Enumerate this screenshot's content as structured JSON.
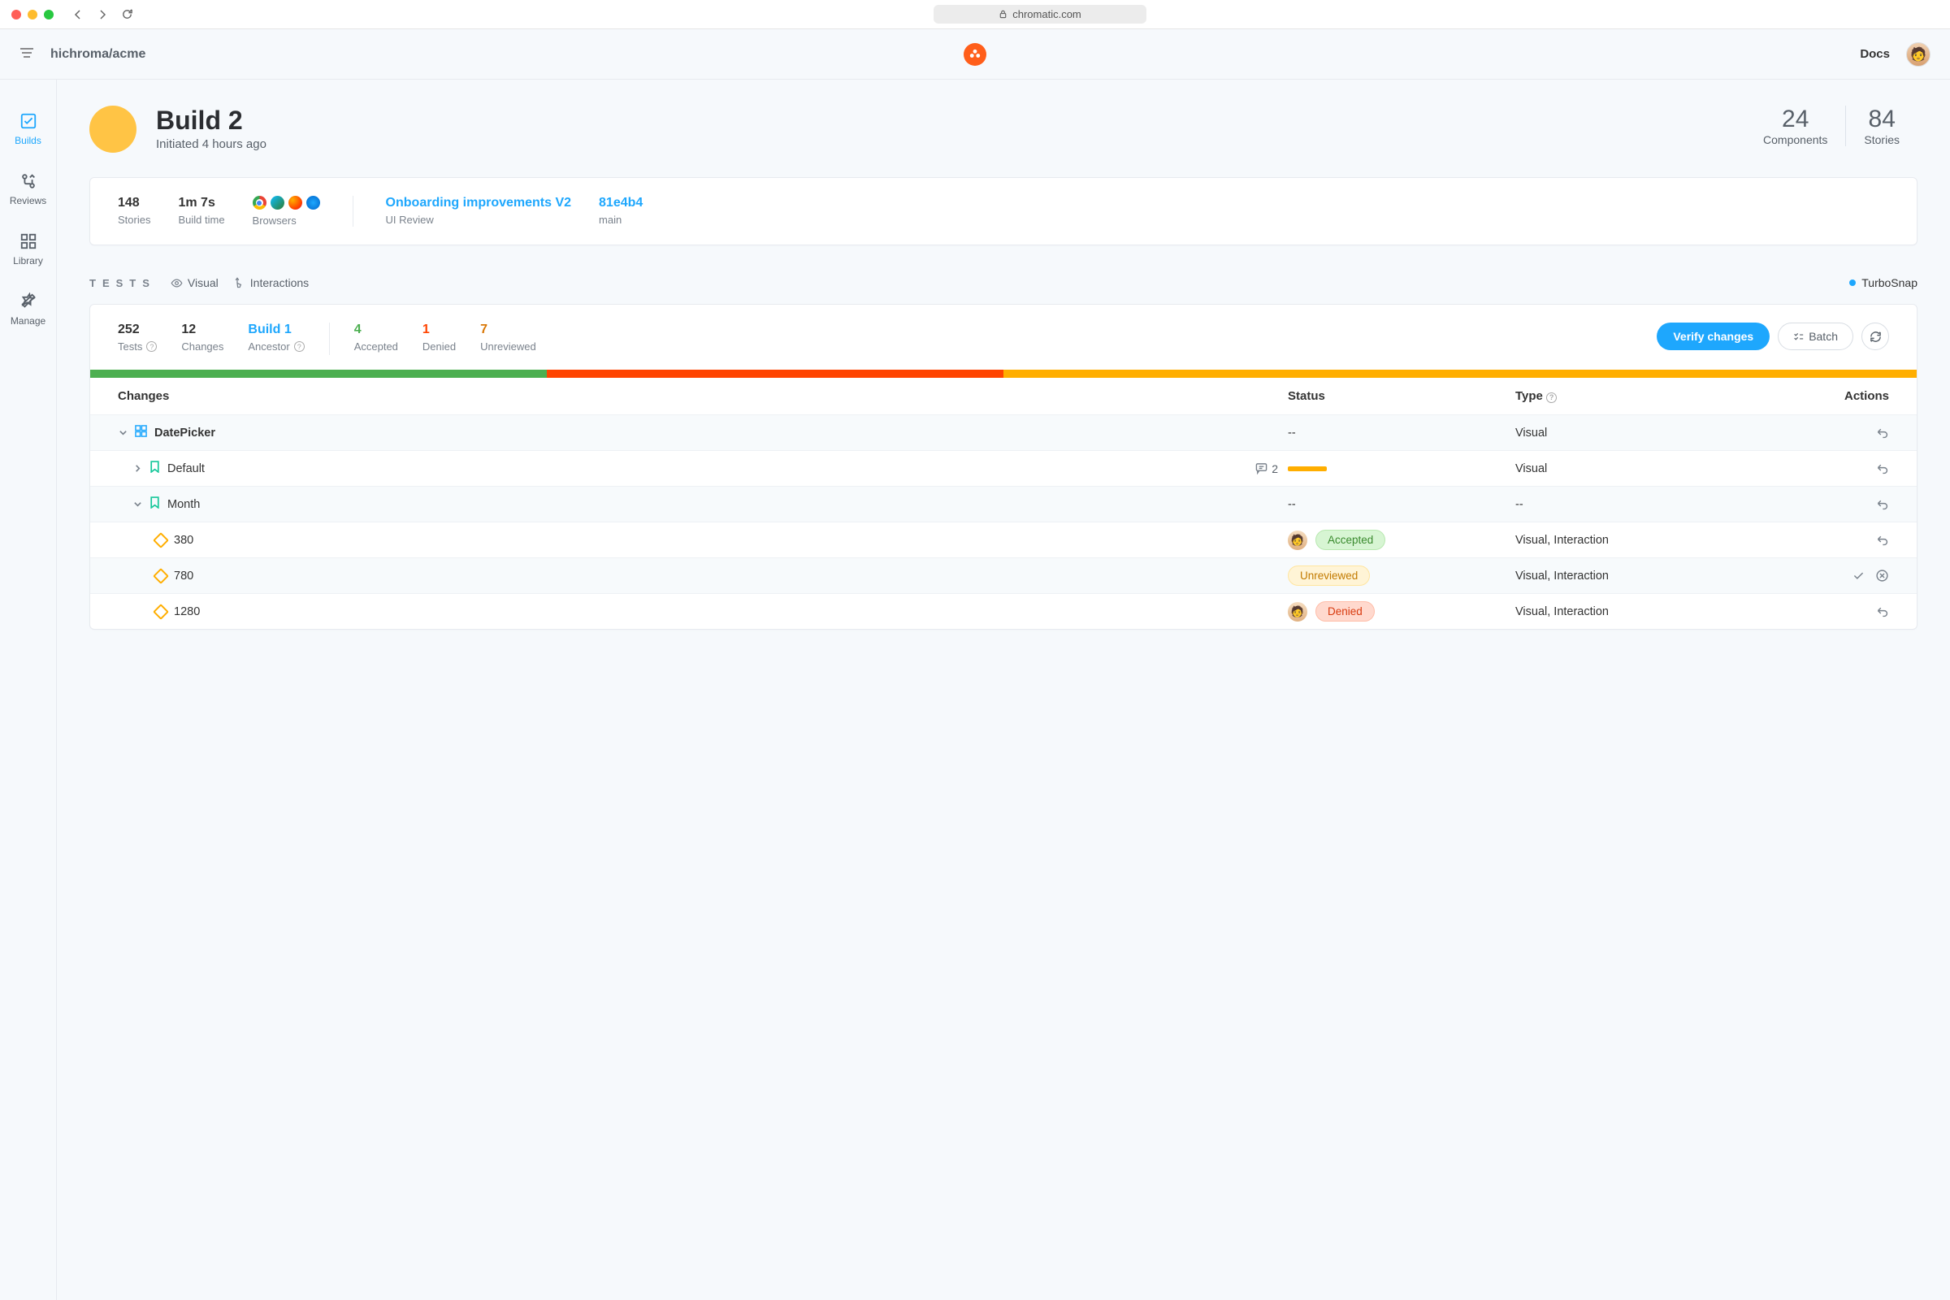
{
  "browser": {
    "url": "chromatic.com"
  },
  "header": {
    "breadcrumb": "hichroma/acme",
    "docs": "Docs"
  },
  "sidebar": {
    "items": [
      {
        "label": "Builds"
      },
      {
        "label": "Reviews"
      },
      {
        "label": "Library"
      },
      {
        "label": "Manage"
      }
    ]
  },
  "build": {
    "title": "Build 2",
    "subtitle": "Initiated 4 hours ago",
    "stats": [
      {
        "num": "24",
        "label": "Components"
      },
      {
        "num": "84",
        "label": "Stories"
      }
    ]
  },
  "info": {
    "stories_num": "148",
    "stories_lbl": "Stories",
    "buildtime_num": "1m 7s",
    "buildtime_lbl": "Build time",
    "browsers_lbl": "Browsers",
    "review_title": "Onboarding improvements V2",
    "review_lbl": "UI Review",
    "commit": "81e4b4",
    "branch": "main"
  },
  "tests_bar": {
    "label": "TESTS",
    "visual": "Visual",
    "interactions": "Interactions",
    "turbo": "TurboSnap"
  },
  "tests_header": {
    "tests_num": "252",
    "tests_lbl": "Tests",
    "changes_num": "12",
    "changes_lbl": "Changes",
    "ancestor_num": "Build 1",
    "ancestor_lbl": "Ancestor",
    "accepted_num": "4",
    "accepted_lbl": "Accepted",
    "denied_num": "1",
    "denied_lbl": "Denied",
    "unreviewed_num": "7",
    "unreviewed_lbl": "Unreviewed",
    "verify_btn": "Verify changes",
    "batch_btn": "Batch"
  },
  "table": {
    "headers": {
      "changes": "Changes",
      "status": "Status",
      "type": "Type",
      "actions": "Actions"
    },
    "rows": [
      {
        "name": "DatePicker",
        "status": "--",
        "type": "Visual"
      },
      {
        "name": "Default",
        "comments": "2",
        "type": "Visual"
      },
      {
        "name": "Month",
        "status": "--",
        "type": "--"
      },
      {
        "name": "380",
        "badge": "Accepted",
        "type": "Visual, Interaction"
      },
      {
        "name": "780",
        "badge": "Unreviewed",
        "type": "Visual, Interaction"
      },
      {
        "name": "1280",
        "badge": "Denied",
        "type": "Visual, Interaction"
      }
    ]
  }
}
